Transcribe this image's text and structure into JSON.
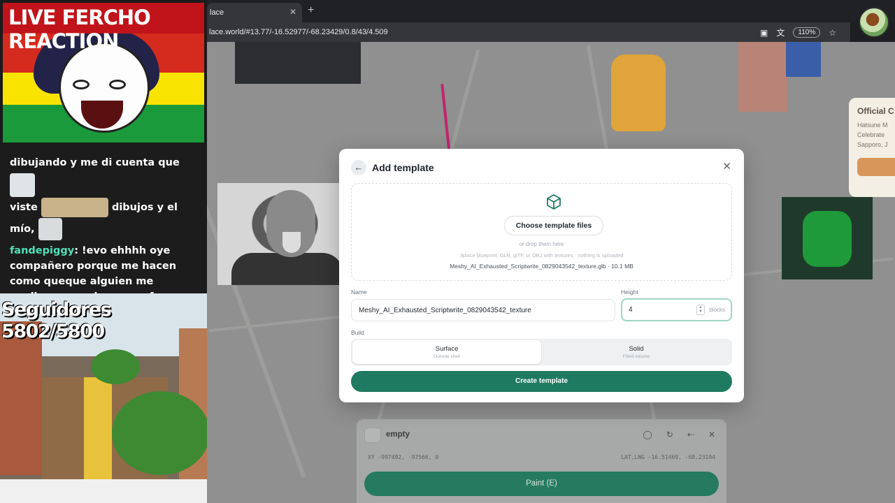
{
  "browser": {
    "tab_title": "lace",
    "url": "lace.world/#13.77/-16.52977/-68.23429/0.8/43/4.509",
    "zoom": "110%"
  },
  "stream": {
    "cam_title": "LIVE FERCHO REACTION",
    "chat": {
      "line1": "dibujando y me di cuenta que",
      "line2a": "viste",
      "line2b": "dibujos y el",
      "line3": "mío,",
      "user": "fandepiggy",
      "message": ": !evo ehhhh oye compañero porque me hacen como queque alguien me explice no se si es una ofensa contra mi"
    },
    "followers": "Seguidores 5802/5800"
  },
  "modal": {
    "title": "Add template",
    "choose_label": "Choose template files",
    "drop_hint": "or drop them here",
    "formats_hint": "3place blueprint, GLB, glTF, or OBJ with textures · nothing is uploaded",
    "file_info": "Meshy_AI_Exhausted_Scriptwrite_0829043542_texture.glb · 10.1 MB",
    "name_label": "Name",
    "name_value": "Meshy_AI_Exhausted_Scriptwrite_0829043542_texture",
    "height_label": "Height",
    "height_value": "4",
    "height_unit": "blocks",
    "build_label": "Build",
    "build_options": [
      {
        "title": "Surface",
        "sub": "Outside shell",
        "selected": true
      },
      {
        "title": "Solid",
        "sub": "Filled volume",
        "selected": false
      }
    ],
    "create_label": "Create template"
  },
  "panel": {
    "name": "empty",
    "xy": "XY -997492, -97566, 0",
    "latlng": "LAT,LNG -16.51469, -68.23194",
    "paint_label": "Paint (E)"
  },
  "side_card": {
    "title": "Official C",
    "line1": "Hatsune M",
    "line2": "Celebrate",
    "line3": "Sapporo, J"
  },
  "colors": {
    "accent": "#1e7a60",
    "height_focus": "#9dd7c7"
  }
}
